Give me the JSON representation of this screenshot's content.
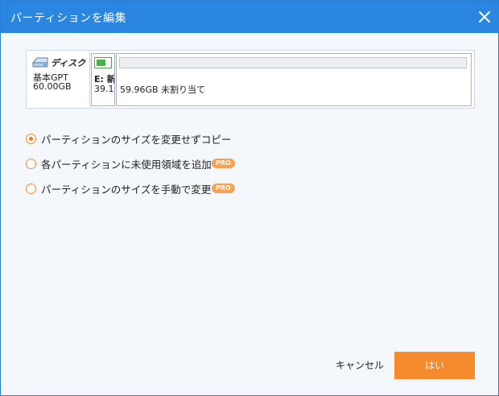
{
  "window": {
    "title": "パーティションを編集",
    "close_icon": "close-icon"
  },
  "disk": {
    "name": "ディスク",
    "type": "基本GPT",
    "size": "60.00GB",
    "icon": "disk-icon"
  },
  "partitions": [
    {
      "label": "E: 新",
      "size": "39.1",
      "used_fraction": 0.55,
      "color": "#49b04a"
    },
    {
      "label": "59.96GB 未割り当て",
      "color": "#eceef1"
    }
  ],
  "options": [
    {
      "label": "パーティションのサイズを変更せずコピー",
      "checked": true,
      "pro": ""
    },
    {
      "label": "各パーティションに未使用領域を追加",
      "checked": false,
      "pro": "PRO"
    },
    {
      "label": "パーティションのサイズを手動で変更",
      "checked": false,
      "pro": "PRO"
    }
  ],
  "buttons": {
    "cancel": "キャンセル",
    "ok": "はい"
  },
  "colors": {
    "titlebar": "#2a86e0",
    "accent": "#f68b2e",
    "pro_badge": "#f6a154"
  }
}
